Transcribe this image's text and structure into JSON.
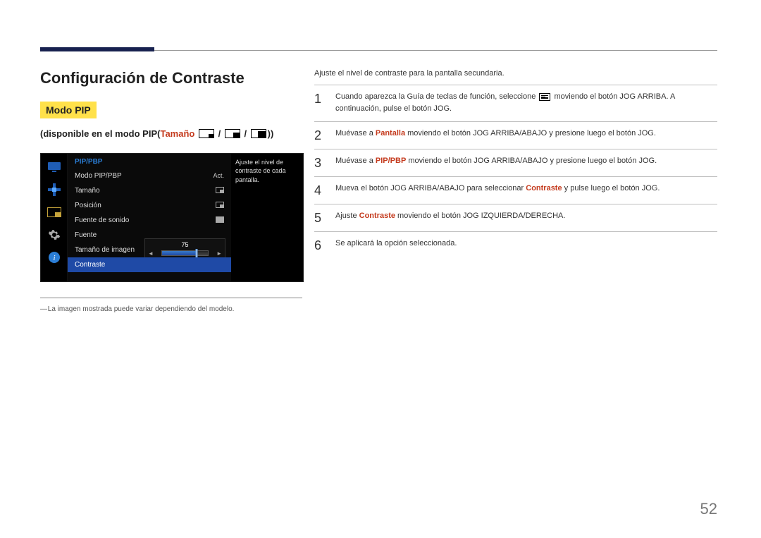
{
  "page": {
    "title": "Configuración de Contraste",
    "mode_badge": "Modo PIP",
    "subheading_prefix": "(disponible en el modo PIP(",
    "subheading_size_label": "Tamaño",
    "subheading_suffix": "))",
    "separator": " / ",
    "page_number": "52"
  },
  "osd": {
    "header": "PIP/PBP",
    "rows": [
      {
        "label": "Modo PIP/PBP",
        "value": "Act."
      },
      {
        "label": "Tamaño",
        "value": ""
      },
      {
        "label": "Posición",
        "value": ""
      },
      {
        "label": "Fuente de sonido",
        "value": ""
      },
      {
        "label": "Fuente",
        "value": ""
      },
      {
        "label": "Tamaño de imagen",
        "value": ""
      },
      {
        "label": "Contraste",
        "value": ""
      }
    ],
    "slider_value": "75",
    "hint": "Ajuste el nivel de contraste de cada pantalla."
  },
  "footnote": "La imagen mostrada puede variar dependiendo del modelo.",
  "intro": "Ajuste el nivel de contraste para la pantalla secundaria.",
  "steps": [
    {
      "num": "1",
      "parts": [
        {
          "t": "Cuando aparezca la Guía de teclas de función, seleccione "
        },
        {
          "icon": "menu"
        },
        {
          "t": " moviendo el botón JOG ARRIBA. A continuación, pulse el botón JOG."
        }
      ]
    },
    {
      "num": "2",
      "parts": [
        {
          "t": "Muévase a "
        },
        {
          "t": "Pantalla",
          "cls": "bold"
        },
        {
          "t": " moviendo el botón JOG ARRIBA/ABAJO y presione luego el botón JOG."
        }
      ]
    },
    {
      "num": "3",
      "parts": [
        {
          "t": "Muévase a "
        },
        {
          "t": "PIP/PBP",
          "cls": "bold"
        },
        {
          "t": " moviendo el botón JOG ARRIBA/ABAJO y presione luego el botón JOG."
        }
      ]
    },
    {
      "num": "4",
      "parts": [
        {
          "t": "Mueva el botón JOG ARRIBA/ABAJO para seleccionar "
        },
        {
          "t": "Contraste",
          "cls": "bold"
        },
        {
          "t": " y pulse luego el botón JOG."
        }
      ]
    },
    {
      "num": "5",
      "parts": [
        {
          "t": "Ajuste "
        },
        {
          "t": "Contraste",
          "cls": "bold"
        },
        {
          "t": " moviendo el botón JOG IZQUIERDA/DERECHA."
        }
      ]
    },
    {
      "num": "6",
      "parts": [
        {
          "t": "Se aplicará la opción seleccionada."
        }
      ]
    }
  ]
}
